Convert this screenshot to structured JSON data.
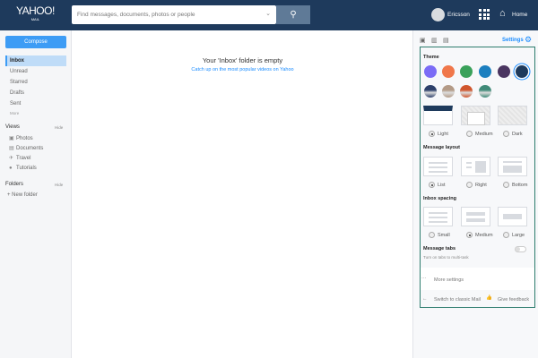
{
  "header": {
    "logo": "YAHOO!",
    "logo_sub": "MAIL",
    "search_placeholder": "Find messages, documents, photos or people",
    "user": "Ericsson",
    "home": "Home"
  },
  "sidebar": {
    "compose": "Compose",
    "folders": [
      {
        "label": "Inbox",
        "selected": true
      },
      {
        "label": "Unread"
      },
      {
        "label": "Starred"
      },
      {
        "label": "Drafts"
      },
      {
        "label": "Sent"
      }
    ],
    "more": "More",
    "views_title": "Views",
    "views_hide": "Hide",
    "views": [
      {
        "label": "Photos",
        "icon": "photo-icon"
      },
      {
        "label": "Documents",
        "icon": "document-icon"
      },
      {
        "label": "Travel",
        "icon": "plane-icon"
      },
      {
        "label": "Tutorials",
        "icon": "help-icon"
      }
    ],
    "folders_title": "Folders",
    "folders_hide": "Hide",
    "new_folder": "+ New folder"
  },
  "main": {
    "empty_title": "Your 'Inbox' folder is empty",
    "empty_link": "Catch up on the most popular videos on Yahoo"
  },
  "settings": {
    "title": "Settings",
    "theme_label": "Theme",
    "theme_colors": [
      "#7b6cf6",
      "#f0774a",
      "#3aa15a",
      "#1c7fbf",
      "#4a3560",
      "#1e3a5c"
    ],
    "theme_images": [
      "#2c3f6a",
      "#b39a86",
      "#d0552c",
      "#3f8a78"
    ],
    "theme_modes": [
      {
        "label": "Light",
        "checked": true
      },
      {
        "label": "Medium"
      },
      {
        "label": "Dark"
      }
    ],
    "layout_label": "Message layout",
    "layouts": [
      {
        "label": "List",
        "checked": true
      },
      {
        "label": "Right"
      },
      {
        "label": "Bottom"
      }
    ],
    "spacing_label": "Inbox spacing",
    "spacings": [
      {
        "label": "Small"
      },
      {
        "label": "Medium",
        "checked": true
      },
      {
        "label": "Large"
      }
    ],
    "tabs_label": "Message tabs",
    "tabs_sub": "Turn on tabs to multi-task",
    "tabs_on": false,
    "more_settings": "More settings",
    "classic": "Switch to classic Mail",
    "feedback": "Give feedback"
  }
}
